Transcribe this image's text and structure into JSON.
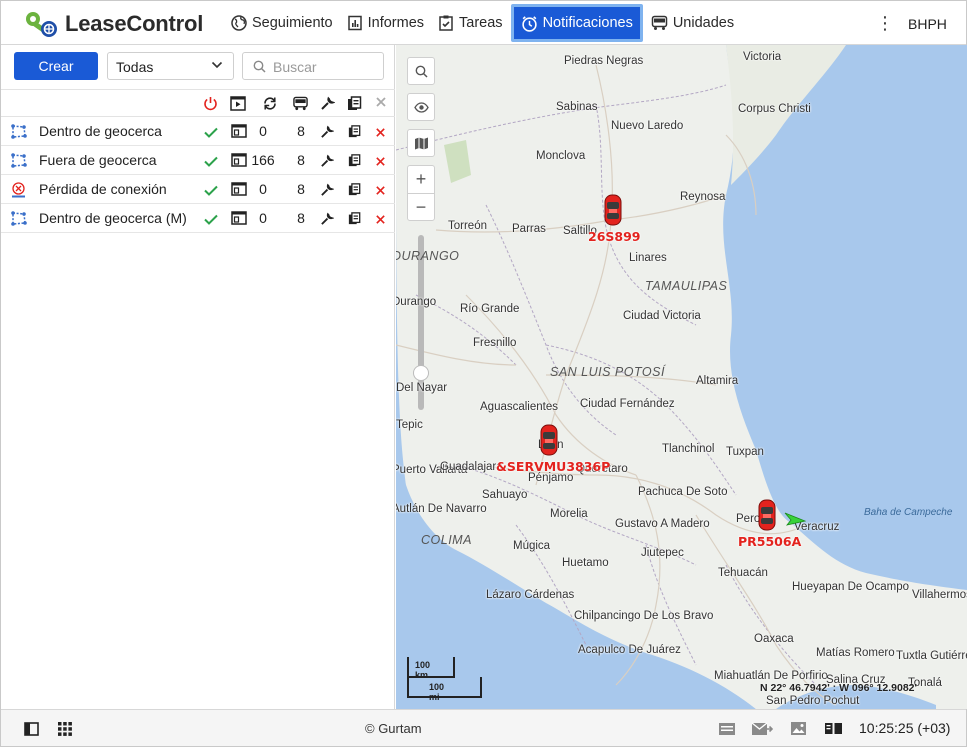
{
  "app": {
    "name": "LeaseControl"
  },
  "nav": {
    "items": [
      {
        "label": "Seguimiento",
        "icon": "globe-icon"
      },
      {
        "label": "Informes",
        "icon": "report-icon"
      },
      {
        "label": "Tareas",
        "icon": "checklist-icon"
      },
      {
        "label": "Notificaciones",
        "icon": "alarm-clock-icon",
        "active": true
      },
      {
        "label": "Unidades",
        "icon": "bus-icon"
      }
    ],
    "menu_icon": "kebab-menu-icon",
    "user": "BHPH"
  },
  "panel": {
    "create_label": "Crear",
    "filter_value": "Todas",
    "search_placeholder": "Buscar",
    "header_icons": [
      "power-icon",
      "play-template-icon",
      "refresh-icon",
      "bus-icon",
      "wrench-icon",
      "copy-icon",
      "close-icon"
    ],
    "rows": [
      {
        "name": "Dentro de geocerca",
        "icon": "geofence-icon",
        "count": "0",
        "units": "8"
      },
      {
        "name": "Fuera de geocerca",
        "icon": "geofence-icon",
        "count": "166",
        "units": "8"
      },
      {
        "name": "Pérdida de conexión",
        "icon": "connection-lost-icon",
        "count": "0",
        "units": "8"
      },
      {
        "name": "Dentro de geocerca (M)",
        "icon": "geofence-icon",
        "count": "0",
        "units": "8"
      }
    ]
  },
  "map": {
    "places": [
      "Piedras Negras",
      "Victoria",
      "Sabinas",
      "Corpus Christi",
      "Nuevo Laredo",
      "Monclova",
      "Reynosa",
      "Torreón",
      "Parras",
      "Saltillo",
      "Linares",
      "TAMAULIPAS",
      "DURANGO",
      "Durango",
      "Río Grande",
      "Ciudad Victoria",
      "Fresnillo",
      "SAN LUIS POTOSÍ",
      "Altamira",
      "Aguascalientes",
      "Ciudad Fernández",
      "Del Nayar",
      "Tepic",
      "Tlanchinol",
      "Tuxpan",
      "Puerto Vallarta",
      "Guadalajara",
      "León",
      "Pénjamo",
      "Querétaro",
      "Pachuca De Soto",
      "Sahuayo",
      "Autlán De Navarro",
      "Morelia",
      "Gustavo A Madero",
      "Perote",
      "Veracruz",
      "Baha de Campeche",
      "COLIMA",
      "Múgica",
      "Jiutepec",
      "Tehuacán",
      "Huetamo",
      "Lázaro Cárdenas",
      "Hueyapan De Ocampo",
      "Villahermosa",
      "Chilpancingo De Los Bravo",
      "Oaxaca",
      "Acapulco De Juárez",
      "Matías Romero",
      "Tuxtla Gutiérrez",
      "Miahuatlán De Porfirio",
      "Salina Cruz",
      "Tonalá",
      "San Pedro Pochut"
    ],
    "vehicles": [
      {
        "plate": "26S899",
        "color": "#e3231e"
      },
      {
        "plate": "&SERVMU3836P",
        "color": "#e3231e"
      },
      {
        "plate": "PR5506A",
        "color": "#e3231e"
      }
    ],
    "scale_km": "100 km",
    "scale_mi": "100 mi",
    "coordinates": "N 22° 46.7942' : W 096° 12.9082'",
    "controls": [
      "search-icon",
      "eye-icon",
      "map-layers-icon",
      "zoom-in-icon",
      "zoom-out-icon"
    ],
    "zoom_in": "+",
    "zoom_out": "−"
  },
  "status": {
    "copyright": "© Gurtam",
    "time": "10:25:25 (+03)",
    "left_icons": [
      "panel-toggle-icon",
      "apps-grid-icon"
    ],
    "right_icons": [
      "messages-icon",
      "mail-forward-icon",
      "image-icon",
      "car-icon",
      "book-icon"
    ]
  },
  "colors": {
    "accent": "#1a5ad6",
    "accent_border": "#7fb3ef",
    "water": "#a8c8ec",
    "plate": "#e3231e"
  }
}
